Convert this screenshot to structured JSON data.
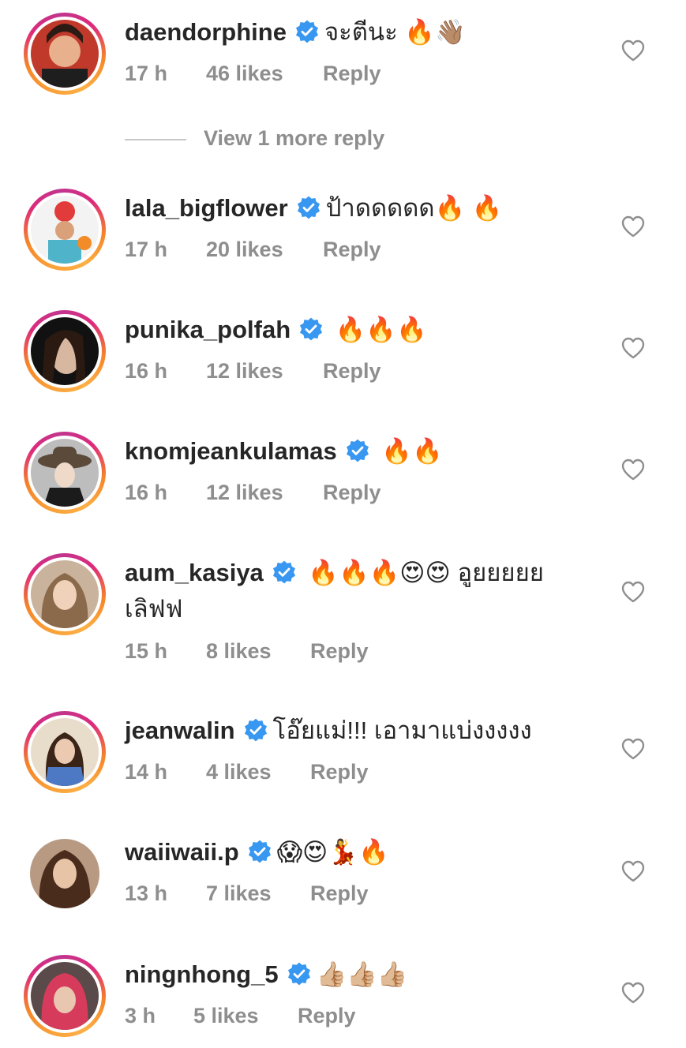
{
  "view_more_replies": "View 1 more reply",
  "reply_label": "Reply",
  "colors": {
    "text": "#262626",
    "secondary": "#8e8e8e",
    "verified_blue": "#3897f0",
    "ring_start": "#f58529",
    "ring_end": "#dd2a7b"
  },
  "comments": [
    {
      "username": "daendorphine",
      "verified": true,
      "text": "จะตีนะ 🔥👋🏽",
      "time": "17 h",
      "likes": "46 likes",
      "avatar_icon": "avatar-photo"
    },
    {
      "username": "lala_bigflower",
      "verified": true,
      "text": "ป้าดดดดด🔥 🔥",
      "time": "17 h",
      "likes": "20 likes",
      "avatar_icon": "avatar-photo"
    },
    {
      "username": "punika_polfah",
      "verified": true,
      "text": " 🔥🔥🔥",
      "time": "16 h",
      "likes": "12 likes",
      "avatar_icon": "avatar-photo"
    },
    {
      "username": "knomjeankulamas",
      "verified": true,
      "text": " 🔥🔥",
      "time": "16 h",
      "likes": "12 likes",
      "avatar_icon": "avatar-photo"
    },
    {
      "username": "aum_kasiya",
      "verified": true,
      "text": " 🔥🔥🔥😍😍 อูยยยยย เลิฟฟ",
      "time": "15 h",
      "likes": "8 likes",
      "avatar_icon": "avatar-photo"
    },
    {
      "username": "jeanwalin",
      "verified": true,
      "text": "โอ๊ยแม่!!! เอามาแบ่งงงงง",
      "time": "14 h",
      "likes": "4 likes",
      "avatar_icon": "avatar-photo"
    },
    {
      "username": "waiiwaii.p",
      "verified": true,
      "text": "😱😍💃🔥",
      "time": "13 h",
      "likes": "7 likes",
      "avatar_icon": "avatar-photo"
    },
    {
      "username": "ningnhong_5",
      "verified": true,
      "text": "👍🏼👍🏼👍🏼",
      "time": "3 h",
      "likes": "5 likes",
      "avatar_icon": "avatar-photo"
    }
  ]
}
